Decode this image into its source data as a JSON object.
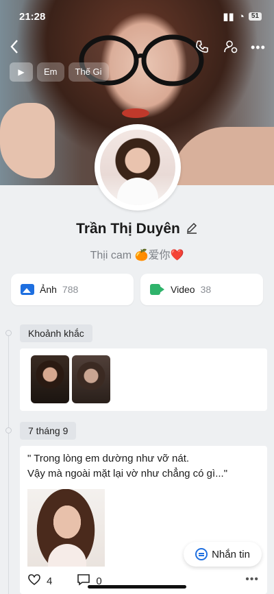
{
  "status_bar": {
    "time": "21:28",
    "battery": "51"
  },
  "cover": {
    "back_icon": "chevron-left-icon",
    "call_icon": "phone-icon",
    "settings_icon": "user-gear-icon",
    "more_icon": "more-horizontal-icon",
    "music_chips": [
      "Em",
      "Thế Gi"
    ]
  },
  "profile": {
    "name": "Trần Thị Duyên",
    "bio": "Thịi cam 🍊爱你❤️"
  },
  "media": {
    "photos": {
      "label": "Ảnh",
      "count": "788"
    },
    "videos": {
      "label": "Video",
      "count": "38"
    }
  },
  "timeline": {
    "moments_label": "Khoảnh khắc",
    "date_label": "7 tháng 9",
    "post": {
      "text_line1": "\" Trong lòng em dường như vỡ nát.",
      "text_line2": "Vậy mà ngoài mặt lại vờ như chẳng có gì...\"",
      "likes": "4",
      "comments": "0"
    }
  },
  "actions": {
    "chat_label": "Nhắn tin"
  }
}
